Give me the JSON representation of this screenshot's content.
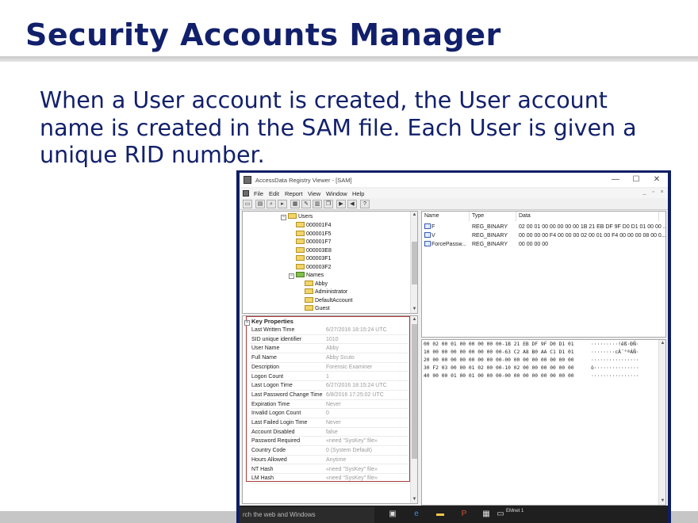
{
  "slide": {
    "title": "Security Accounts Manager",
    "body_line1": "When a User account is created, the User account",
    "body_line2": "name is created in the SAM file.  Each User is given a",
    "body_line3": "unique RID number."
  },
  "window": {
    "title": "AccessData Registry Viewer - [SAM]",
    "minimize": "—",
    "maximize": "☐",
    "close": "✕"
  },
  "menu": [
    "File",
    "Edit",
    "Report",
    "View",
    "Window",
    "Help"
  ],
  "tree": {
    "users_label": "Users",
    "user_keys": [
      "000001F4",
      "000001F5",
      "000001F7",
      "000003E8",
      "000003F1",
      "000003F2"
    ],
    "names_label": "Names",
    "names": [
      "Abby",
      "Administrator",
      "DefaultAccount",
      "Guest"
    ]
  },
  "properties": {
    "header": "Key Properties",
    "rows": [
      {
        "key": "Last Written Time",
        "value": "6/27/2016 18:15:24 UTC"
      },
      {
        "key": "SID unique identifier",
        "value": "1010"
      },
      {
        "key": "User Name",
        "value": "Abby"
      },
      {
        "key": "Full Name",
        "value": "Abby Scuto"
      },
      {
        "key": "Description",
        "value": "Forensic Examiner"
      },
      {
        "key": "Logon Count",
        "value": "1"
      },
      {
        "key": "Last Logon Time",
        "value": "6/27/2016 18:15:24 UTC"
      },
      {
        "key": "Last Password Change Time",
        "value": "6/8/2016 17:25:02 UTC"
      },
      {
        "key": "Expiration Time",
        "value": "Never"
      },
      {
        "key": "Invalid Logon Count",
        "value": "0"
      },
      {
        "key": "Last Failed Login Time",
        "value": "Never"
      },
      {
        "key": "Account Disabled",
        "value": "false"
      },
      {
        "key": "Password Required",
        "value": "«need \"SysKey\" file»"
      },
      {
        "key": "Country Code",
        "value": "0 (System Default)"
      },
      {
        "key": "Hours Allowed",
        "value": "Anytime"
      },
      {
        "key": "NT Hash",
        "value": "«need \"SysKey\" file»"
      },
      {
        "key": "LM Hash",
        "value": "«need \"SysKey\" file»"
      }
    ]
  },
  "values_table": {
    "headers": [
      "Name",
      "Type",
      "Data"
    ],
    "rows": [
      {
        "name": "F",
        "type": "REG_BINARY",
        "data": "02 00 01 00 00 00 00 00 1B 21 EB DF 9F D0 D1 01 00 00 ..."
      },
      {
        "name": "V",
        "type": "REG_BINARY",
        "data": "00 00 00 00 F4 00 00 00 02 00 01 00 F4 00 00 00 08 00 0..."
      },
      {
        "name": "ForcePassw...",
        "type": "REG_BINARY",
        "data": "00 00 00 00"
      }
    ]
  },
  "hex": {
    "rows": [
      {
        "hex": "00 02 00 01 00 00 00 00 00-1B 21 EB DF 9F D0 D1 01",
        "ascii": "·········!ëß·ÐÑ·"
      },
      {
        "hex": "10 00 00 00 00 00 00 00 00-63 C2 A8 B0 AA C1 D1 01",
        "ascii": "········cÂ¨°ªÁÑ·"
      },
      {
        "hex": "20 00 00 00 00 00 00 00 00-00 00 00 00 00 00 00 00",
        "ascii": "················"
      },
      {
        "hex": "30 F2 03 00 00 01 02 00 00-10 02 00 00 00 00 00 00",
        "ascii": "ò···············"
      },
      {
        "hex": "40 00 00 01 00 01 00 00 00-00 00 00 00 00 00 00 00",
        "ascii": "················"
      }
    ]
  },
  "taskbar": {
    "search_text": "rch the web and Windows",
    "item_label": "EMnet 1"
  },
  "colors": {
    "title": "#12206b",
    "frame": "#0e1e63",
    "highlight_border": "#a83a3a"
  }
}
